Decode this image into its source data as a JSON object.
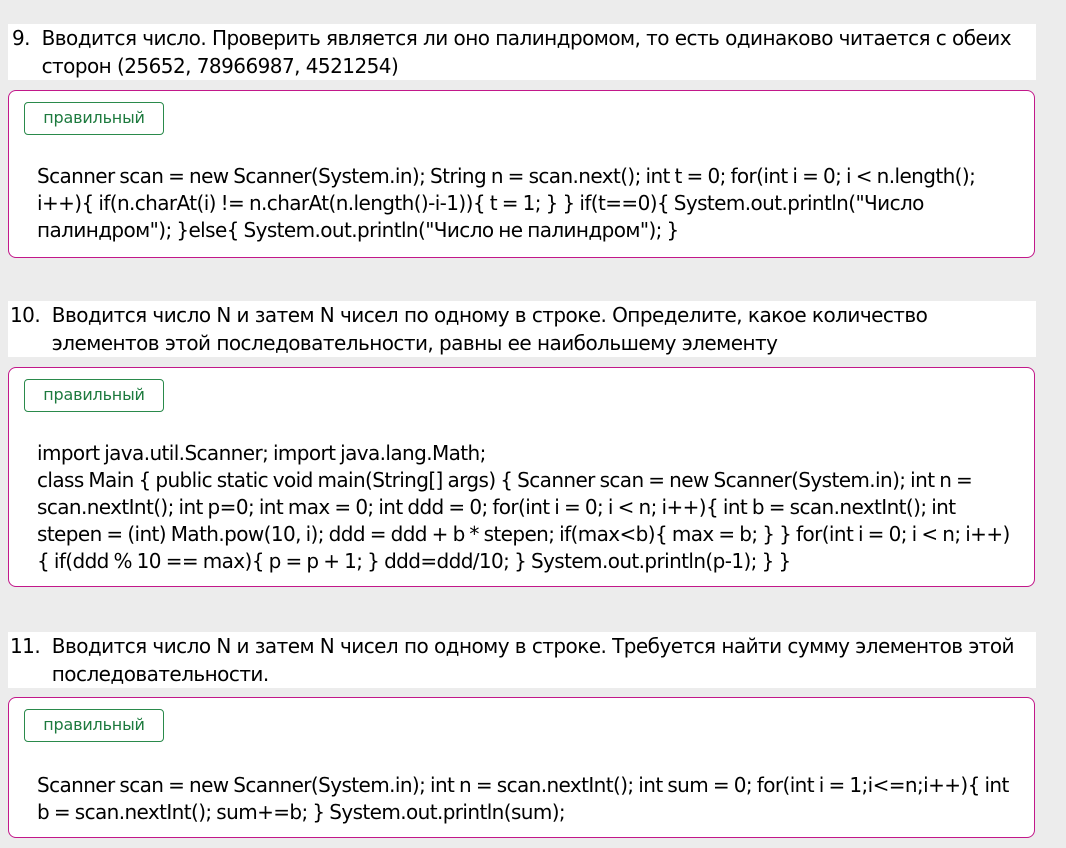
{
  "tasks": [
    {
      "number": "9.  ",
      "question": "Вводится число. Проверить является ли оно палиндромом, то есть одинаково читается с обеих сторон (25652, 78966987, 4521254)",
      "badge": "правильный",
      "code_lines": [
        "Scanner scan = new Scanner(System.in); String n = scan.next(); int t = 0; for(int i = 0; i < n.length(); i++){ if(n.charAt(i) != n.charAt(n.length()-i-1)){ t = 1; } } if(t==0){ System.out.println(\"Число палиндром\"); }else{ System.out.println(\"Число не палиндром\"); }"
      ]
    },
    {
      "number": "10.  ",
      "question": "Вводится число N и затем N чисел по одному в строке. Определите, какое количество элементов этой последовательности, равны ее наибольшему элементу",
      "badge": "правильный",
      "code_lines": [
        "import java.util.Scanner; import java.lang.Math;",
        "class Main { public static void main(String[] args) { Scanner scan = new Scanner(System.in); int n = scan.nextInt(); int p=0; int max = 0; int ddd = 0; for(int i = 0; i < n; i++){ int b = scan.nextInt(); int stepen = (int) Math.pow(10, i); ddd = ddd + b * stepen; if(max<b){ max = b; } } for(int i = 0; i < n; i++){ if(ddd % 10 == max){ p = p + 1; } ddd=ddd/10; } System.out.println(p-1); } }"
      ]
    },
    {
      "number": "11.  ",
      "question": "Вводится число N и затем N чисел по одному в строке. Требуется найти сумму элементов этой последовательности.",
      "badge": "правильный",
      "code_lines": [
        "Scanner scan = new Scanner(System.in); int n = scan.nextInt(); int sum = 0; for(int i = 1;i<=n;i++){ int b = scan.nextInt(); sum+=b; } System.out.println(sum);"
      ]
    }
  ]
}
